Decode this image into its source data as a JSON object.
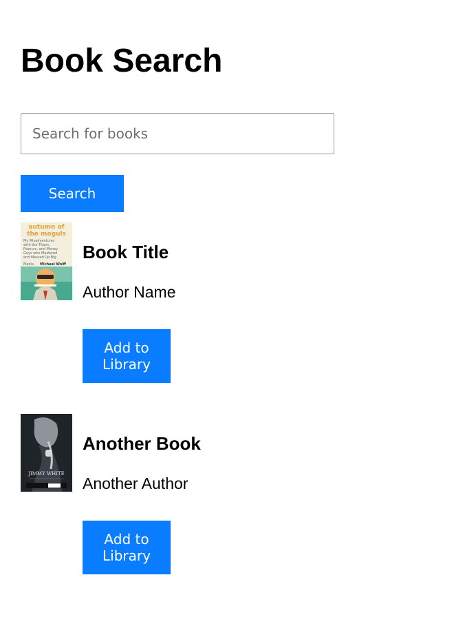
{
  "page": {
    "title": "Book Search"
  },
  "search": {
    "placeholder": "Search for books",
    "value": "",
    "button_label": "Search"
  },
  "colors": {
    "accent": "#0a7cff",
    "button_text": "#ffffff"
  },
  "books": [
    {
      "title": "Book Title",
      "author": "Author Name",
      "add_label": "Add to Library",
      "cover_text": {
        "headline": "autumn of the moguls",
        "subtitle": "My Misadventures with the Titans, Poseurs, and Money Guys who Mastered and Messed Up Big Media",
        "author": "Michael Wolff"
      }
    },
    {
      "title": "Another Book",
      "author": "Another Author",
      "add_label": "Add to Library",
      "cover_text": {
        "author": "JIMMY WHITE"
      }
    }
  ]
}
